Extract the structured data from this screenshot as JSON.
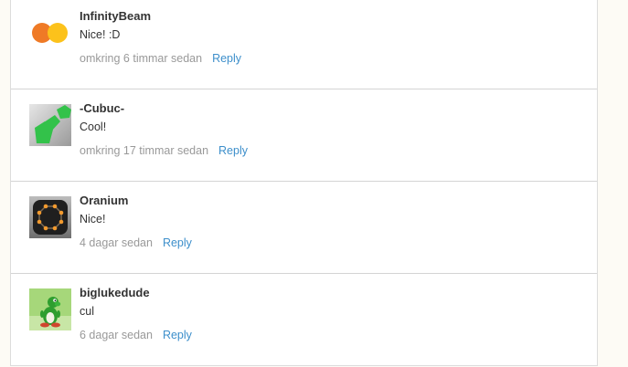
{
  "comments": [
    {
      "author": "InfinityBeam",
      "text": "Nice! :D",
      "time": "omkring 6 timmar sedan",
      "reply_label": "Reply",
      "avatar_icon": "two-circles-orange-yellow"
    },
    {
      "author": "-Cubuc-",
      "text": "Cool!",
      "time": "omkring 17 timmar sedan",
      "reply_label": "Reply",
      "avatar_icon": "green-pentagons"
    },
    {
      "author": "Oranium",
      "text": "Nice!",
      "time": "4 dagar sedan",
      "reply_label": "Reply",
      "avatar_icon": "orange-octagon-dark"
    },
    {
      "author": "biglukedude",
      "text": "cul",
      "time": "6 dagar sedan",
      "reply_label": "Reply",
      "avatar_icon": "green-dinosaur"
    }
  ],
  "colors": {
    "link": "#3d8fcb",
    "timestamp": "#999999",
    "author": "#333333",
    "page_background": "#fdfbf5"
  }
}
